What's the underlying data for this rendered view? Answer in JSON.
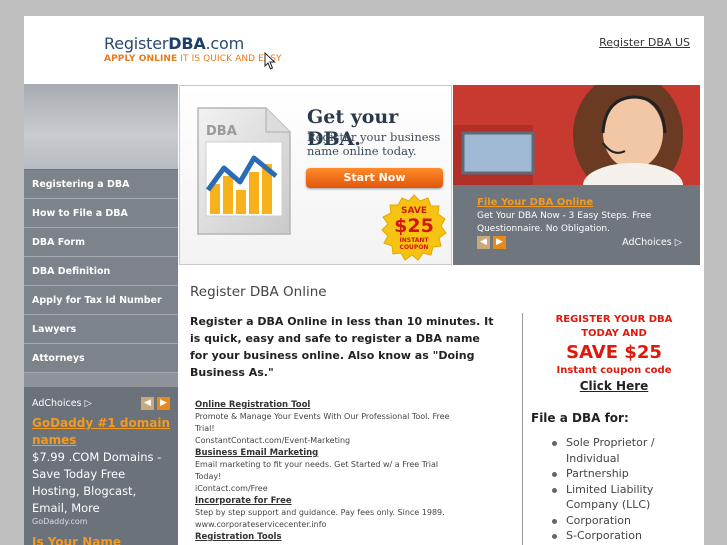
{
  "header": {
    "logo_prefix": "Register",
    "logo_bold": "DBA",
    "logo_suffix": ".com",
    "tagline_bold": "APPLY ONLINE",
    "tagline_rest": " IT IS QUICK AND EASY",
    "top_link": "Register DBA US"
  },
  "sidebar": {
    "items": [
      {
        "label": "Registering a DBA"
      },
      {
        "label": "How to File a DBA"
      },
      {
        "label": "DBA Form"
      },
      {
        "label": "DBA Definition"
      },
      {
        "label": "Apply for Tax Id Number"
      },
      {
        "label": "Lawyers"
      },
      {
        "label": "Attorneys"
      }
    ],
    "ads": {
      "adchoices": "AdChoices",
      "title1": "GoDaddy #1 domain names",
      "text1": "$7.99 .COM Domains - Save Today Free Hosting, Blogcast, Email, More",
      "url1": "GoDaddy.com",
      "title2": "Is Your Name Available?"
    }
  },
  "banner": {
    "doc_label": "DBA",
    "title": "Get your DBA.",
    "subtitle": "Register your business name online today.",
    "button": "Start Now",
    "badge_save": "SAVE",
    "badge_amount": "$25",
    "badge_instant": "INSTANT",
    "badge_coupon": "COUPON"
  },
  "right_ad": {
    "title": "File Your DBA Online",
    "text": "Get Your DBA Now - 3 Easy Steps. Free Questionnaire. No Obligation.",
    "adchoices": "AdChoices"
  },
  "content": {
    "title": "Register DBA Online",
    "lead": "Register a DBA Online in less than 10 minutes. It is quick, easy and safe to register a DBA name for your business online. Also know as \"Doing Business As.\"",
    "links": [
      {
        "title": "Online Registration Tool",
        "desc": "Promote & Manage Your Events With Our Professional Tool. Free Trial!",
        "url": "ConstantContact.com/Event-Marketing"
      },
      {
        "title": "Business Email Marketing",
        "desc": "Email marketing to fit your needs. Get Started w/ a Free Trial Today!",
        "url": "iContact.com/Free"
      },
      {
        "title": "Incorporate for Free",
        "desc": "Step by step support and guidance. Pay fees only. Since 1989.",
        "url": "www.corporateservicecenter.info"
      },
      {
        "title": "Registration Tools",
        "desc": "",
        "url": ""
      }
    ]
  },
  "promo": {
    "line1": "REGISTER YOUR DBA",
    "line2": "TODAY AND",
    "save": "SAVE $25",
    "coupon": "Instant coupon code",
    "click": "Click Here",
    "file_for": "File a DBA for:",
    "types": [
      "Sole Proprietor / Individual",
      "Partnership",
      "Limited Liability Company (LLC)",
      "Corporation",
      "S-Corporation"
    ]
  },
  "colors": {
    "accent_orange": "#e87a1e",
    "promo_red": "#e0180c",
    "sidebar_gray": "#7d838a"
  }
}
